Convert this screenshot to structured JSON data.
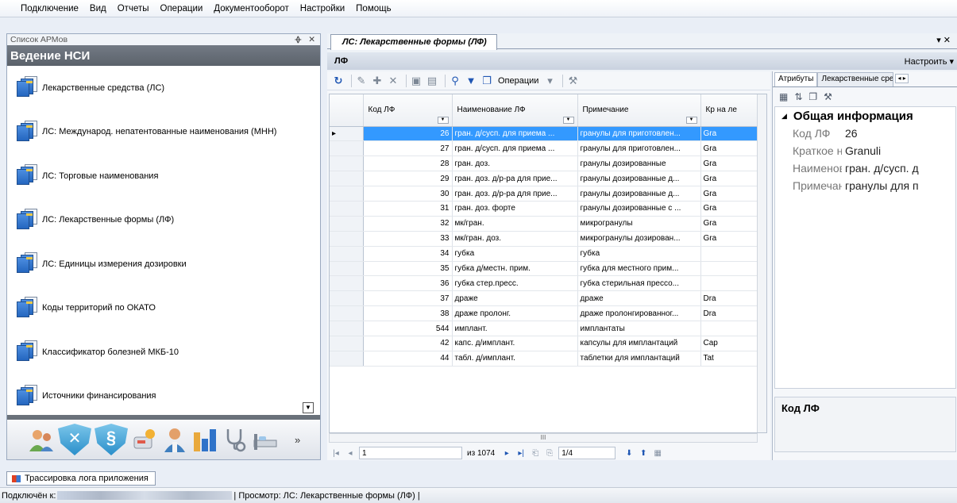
{
  "menu": [
    "Подключение",
    "Вид",
    "Отчеты",
    "Операции",
    "Документооборот",
    "Настройки",
    "Помощь"
  ],
  "left_panel": {
    "caption": "Список АРМов",
    "pin": "ᚖ",
    "close": "✕",
    "title": "Ведение НСИ",
    "items": [
      "Лекарственные средства (ЛС)",
      "ЛС: Международ. непатентованные наименования (МНН)",
      "ЛС: Торговые наименования",
      "ЛС: Лекарственные формы (ЛФ)",
      "ЛС: Единицы измерения дозировки",
      "Коды территорий по ОКАТО",
      "Классификатор болезней МКБ-10",
      "Источники финансирования"
    ],
    "more_glyph": "»"
  },
  "doc": {
    "tab_title": "ЛС: Лекарственные формы (ЛФ)",
    "tab_ctrl": "▾ ✕",
    "header_title": "ЛФ",
    "configure_label": "Настроить ▾",
    "toolbar_ops_label": "Операции"
  },
  "grid": {
    "columns": [
      "Код ЛФ",
      "Наименование ЛФ",
      "Примечание",
      "Кр на ле"
    ],
    "rows": [
      {
        "code": "26",
        "name": "гран. д/сусп. для приема ...",
        "note": "гранулы для приготовлен...",
        "extra": "Gra"
      },
      {
        "code": "27",
        "name": "гран. д/сусп. для приема ...",
        "note": "гранулы для приготовлен...",
        "extra": "Gra"
      },
      {
        "code": "28",
        "name": "гран. доз.",
        "note": "гранулы дозированные",
        "extra": "Gra"
      },
      {
        "code": "29",
        "name": "гран. доз. д/р-ра для прие...",
        "note": "гранулы дозированные д...",
        "extra": "Gra"
      },
      {
        "code": "30",
        "name": "гран. доз. д/р-ра для прие...",
        "note": "гранулы дозированные д...",
        "extra": "Gra"
      },
      {
        "code": "31",
        "name": "гран. доз. форте",
        "note": "гранулы дозированные с ...",
        "extra": "Gra"
      },
      {
        "code": "32",
        "name": "мк/гран.",
        "note": "микрогранулы",
        "extra": "Gra"
      },
      {
        "code": "33",
        "name": "мк/гран. доз.",
        "note": "микрогранулы дозирован...",
        "extra": "Gra"
      },
      {
        "code": "34",
        "name": "губка",
        "note": "губка",
        "extra": ""
      },
      {
        "code": "35",
        "name": "губка д/местн. прим.",
        "note": "губка для местного прим...",
        "extra": ""
      },
      {
        "code": "36",
        "name": "губка стер.пресс.",
        "note": "губка стерильная прессо...",
        "extra": ""
      },
      {
        "code": "37",
        "name": "драже",
        "note": "драже",
        "extra": "Dra"
      },
      {
        "code": "38",
        "name": "драже пролонг.",
        "note": "драже пролонгированног...",
        "extra": "Dra"
      },
      {
        "code": "544",
        "name": "имплант.",
        "note": "имплантаты",
        "extra": ""
      },
      {
        "code": "42",
        "name": "капс. д/имплант.",
        "note": "капсулы для имплантаций",
        "extra": "Cap"
      },
      {
        "code": "44",
        "name": "табл. д/имплант.",
        "note": "таблетки для имплантаций",
        "extra": "Tat"
      }
    ],
    "hscroll_glyph": "III",
    "pager": {
      "current": "1",
      "total": "из 1074",
      "page": "1/4"
    }
  },
  "attributes": {
    "tabs": [
      "Атрибуты",
      "Лекарственные средства"
    ],
    "category": "Общая информация",
    "props": [
      {
        "name": "Код ЛФ",
        "value": "26"
      },
      {
        "name": "Краткое наименование",
        "value": "Granuli"
      },
      {
        "name": "Наименование",
        "value": "гран. д/сусп. д"
      },
      {
        "name": "Примечание",
        "value": "гранулы для п"
      }
    ],
    "description": "Код ЛФ"
  },
  "bottom": {
    "trace_tab": "Трассировка лога приложения",
    "status_connected": "Подключён к:",
    "status_view": "| Просмотр: ЛС: Лекарственные формы (ЛФ) |"
  }
}
